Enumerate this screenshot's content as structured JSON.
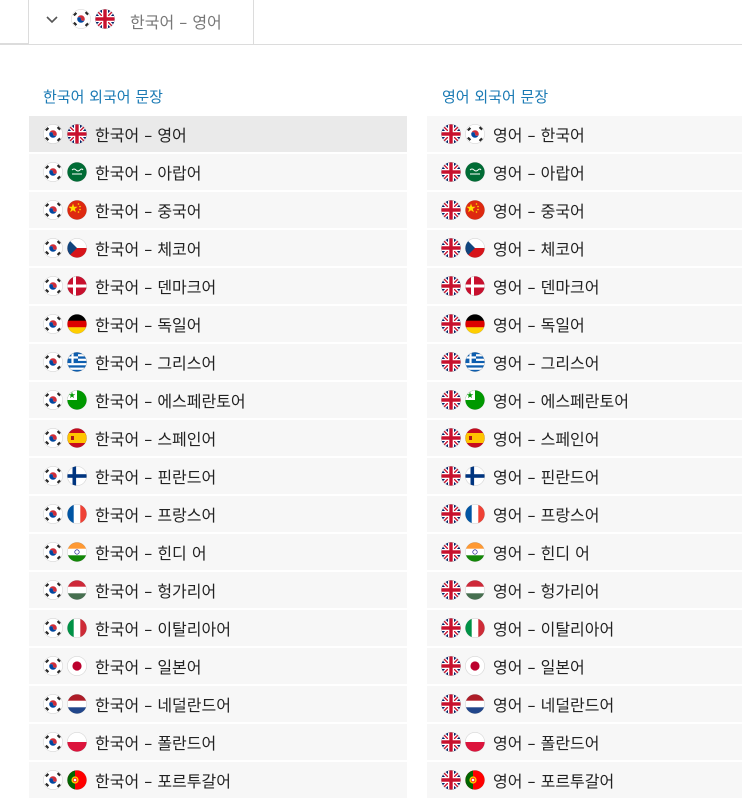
{
  "tab": {
    "label": "한국어 – 영어",
    "flags": [
      "kr",
      "gb"
    ]
  },
  "left_column": {
    "title": "한국어 외국어 문장",
    "items": [
      {
        "label": "한국어 – 영어",
        "flags": [
          "kr",
          "gb"
        ],
        "active": true
      },
      {
        "label": "한국어 – 아랍어",
        "flags": [
          "kr",
          "sa"
        ]
      },
      {
        "label": "한국어 – 중국어",
        "flags": [
          "kr",
          "cn"
        ]
      },
      {
        "label": "한국어 – 체코어",
        "flags": [
          "kr",
          "cz"
        ]
      },
      {
        "label": "한국어 – 덴마크어",
        "flags": [
          "kr",
          "dk"
        ]
      },
      {
        "label": "한국어 – 독일어",
        "flags": [
          "kr",
          "de"
        ]
      },
      {
        "label": "한국어 – 그리스어",
        "flags": [
          "kr",
          "gr"
        ]
      },
      {
        "label": "한국어 – 에스페란토어",
        "flags": [
          "kr",
          "eo"
        ]
      },
      {
        "label": "한국어 – 스페인어",
        "flags": [
          "kr",
          "es"
        ]
      },
      {
        "label": "한국어 – 핀란드어",
        "flags": [
          "kr",
          "fi"
        ]
      },
      {
        "label": "한국어 – 프랑스어",
        "flags": [
          "kr",
          "fr"
        ]
      },
      {
        "label": "한국어 – 힌디 어",
        "flags": [
          "kr",
          "in"
        ]
      },
      {
        "label": "한국어 – 헝가리어",
        "flags": [
          "kr",
          "hu"
        ]
      },
      {
        "label": "한국어 – 이탈리아어",
        "flags": [
          "kr",
          "it"
        ]
      },
      {
        "label": "한국어 – 일본어",
        "flags": [
          "kr",
          "jp"
        ]
      },
      {
        "label": "한국어 – 네덜란드어",
        "flags": [
          "kr",
          "nl"
        ]
      },
      {
        "label": "한국어 – 폴란드어",
        "flags": [
          "kr",
          "pl"
        ]
      },
      {
        "label": "한국어 – 포르투갈어",
        "flags": [
          "kr",
          "pt"
        ]
      }
    ]
  },
  "right_column": {
    "title": "영어 외국어 문장",
    "items": [
      {
        "label": "영어 – 한국어",
        "flags": [
          "gb",
          "kr"
        ]
      },
      {
        "label": "영어 – 아랍어",
        "flags": [
          "gb",
          "sa"
        ]
      },
      {
        "label": "영어 – 중국어",
        "flags": [
          "gb",
          "cn"
        ]
      },
      {
        "label": "영어 – 체코어",
        "flags": [
          "gb",
          "cz"
        ]
      },
      {
        "label": "영어 – 덴마크어",
        "flags": [
          "gb",
          "dk"
        ]
      },
      {
        "label": "영어 – 독일어",
        "flags": [
          "gb",
          "de"
        ]
      },
      {
        "label": "영어 – 그리스어",
        "flags": [
          "gb",
          "gr"
        ]
      },
      {
        "label": "영어 – 에스페란토어",
        "flags": [
          "gb",
          "eo"
        ]
      },
      {
        "label": "영어 – 스페인어",
        "flags": [
          "gb",
          "es"
        ]
      },
      {
        "label": "영어 – 핀란드어",
        "flags": [
          "gb",
          "fi"
        ]
      },
      {
        "label": "영어 – 프랑스어",
        "flags": [
          "gb",
          "fr"
        ]
      },
      {
        "label": "영어 – 힌디 어",
        "flags": [
          "gb",
          "in"
        ]
      },
      {
        "label": "영어 – 헝가리어",
        "flags": [
          "gb",
          "hu"
        ]
      },
      {
        "label": "영어 – 이탈리아어",
        "flags": [
          "gb",
          "it"
        ]
      },
      {
        "label": "영어 – 일본어",
        "flags": [
          "gb",
          "jp"
        ]
      },
      {
        "label": "영어 – 네덜란드어",
        "flags": [
          "gb",
          "nl"
        ]
      },
      {
        "label": "영어 – 폴란드어",
        "flags": [
          "gb",
          "pl"
        ]
      },
      {
        "label": "영어 – 포르투갈어",
        "flags": [
          "gb",
          "pt"
        ]
      }
    ]
  }
}
